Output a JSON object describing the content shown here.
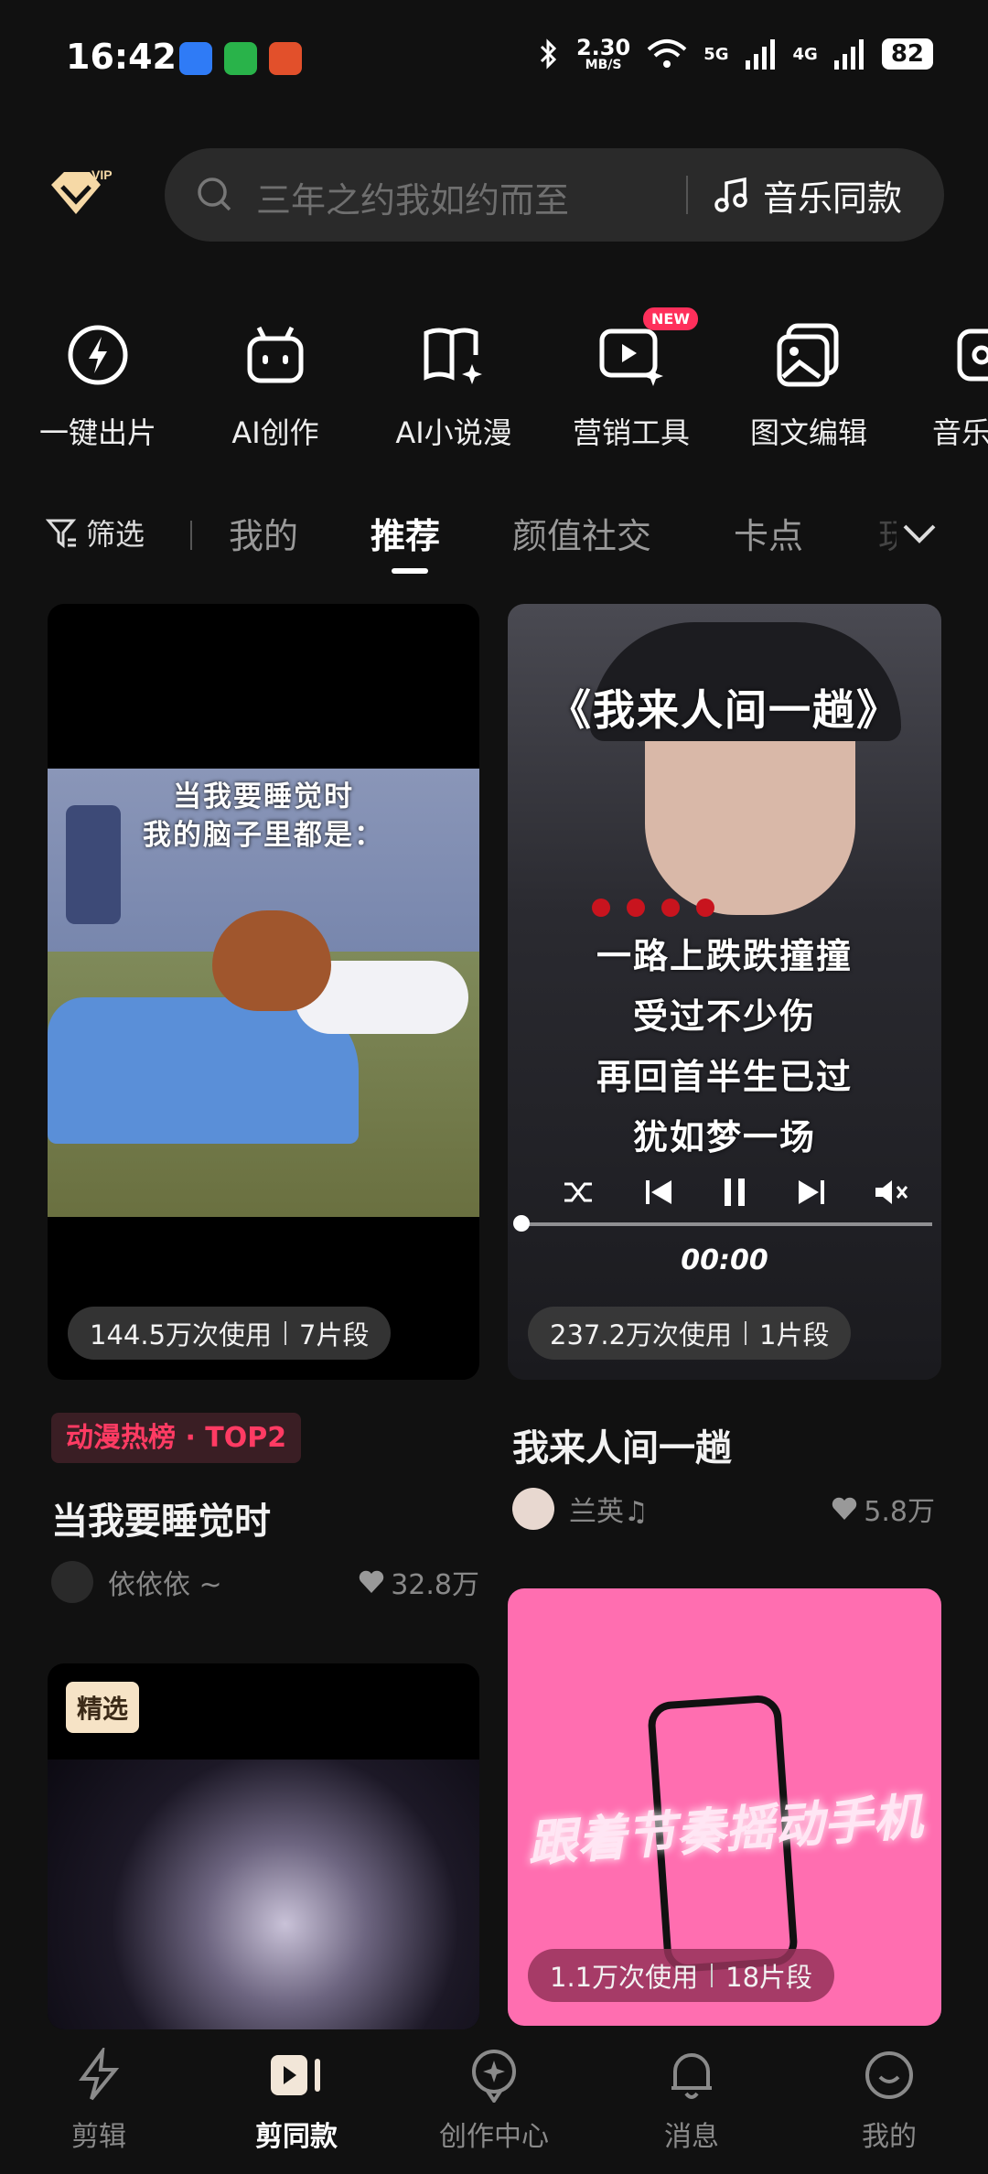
{
  "status_bar": {
    "time": "16:42",
    "net_speed_top": "2.30",
    "net_speed_unit": "MB/S",
    "net_5g": "5G",
    "net_4g": "4G",
    "battery": "82"
  },
  "search": {
    "placeholder": "三年之约我如约而至",
    "music_label": "音乐同款"
  },
  "tools": [
    {
      "label": "一键出片",
      "icon": "lightning-icon"
    },
    {
      "label": "AI创作",
      "icon": "robot-icon"
    },
    {
      "label": "AI小说漫",
      "icon": "book-sparkle-icon"
    },
    {
      "label": "营销工具",
      "icon": "play-sparkle-icon",
      "badge": "NEW"
    },
    {
      "label": "图文编辑",
      "icon": "image-edit-icon"
    },
    {
      "label": "音乐",
      "icon": "music-icon"
    }
  ],
  "filter": {
    "label": "筛选"
  },
  "tabs": [
    {
      "label": "我的"
    },
    {
      "label": "推荐"
    },
    {
      "label": "颜值社交"
    },
    {
      "label": "卡点"
    },
    {
      "label": "玩"
    }
  ],
  "cards": [
    {
      "overlay_line1": "当我要睡觉时",
      "overlay_line2": "我的脑子里都是：",
      "uses": "144.5万次使用",
      "clips": "7片段",
      "rank_badge": "动漫热榜 · TOP2",
      "title": "当我要睡觉时",
      "author": "依依依 ~",
      "likes": "32.8万"
    },
    {
      "overlay_title": "《我来人间一趟》",
      "lyrics": [
        "一路上跌跌撞撞",
        "受过不少伤",
        "再回首半生已过",
        "犹如梦一场"
      ],
      "player_time": "00:00",
      "uses": "237.2万次使用",
      "clips": "1片段",
      "title": "我来人间一趟",
      "author": "兰英♫",
      "likes": "5.8万"
    },
    {
      "badge": "精选"
    },
    {
      "overlay_text": "跟着节奏摇动手机",
      "uses": "1.1万次使用",
      "clips": "18片段"
    }
  ],
  "nav": [
    {
      "label": "剪辑",
      "icon": "lightning-icon"
    },
    {
      "label": "剪同款",
      "icon": "template-play-icon",
      "active": true
    },
    {
      "label": "创作中心",
      "icon": "creator-icon"
    },
    {
      "label": "消息",
      "icon": "bell-icon"
    },
    {
      "label": "我的",
      "icon": "profile-icon"
    }
  ],
  "colors": {
    "background": "#111111",
    "accent_red": "#ff2f5b",
    "pink_card": "#ff6eb0"
  }
}
